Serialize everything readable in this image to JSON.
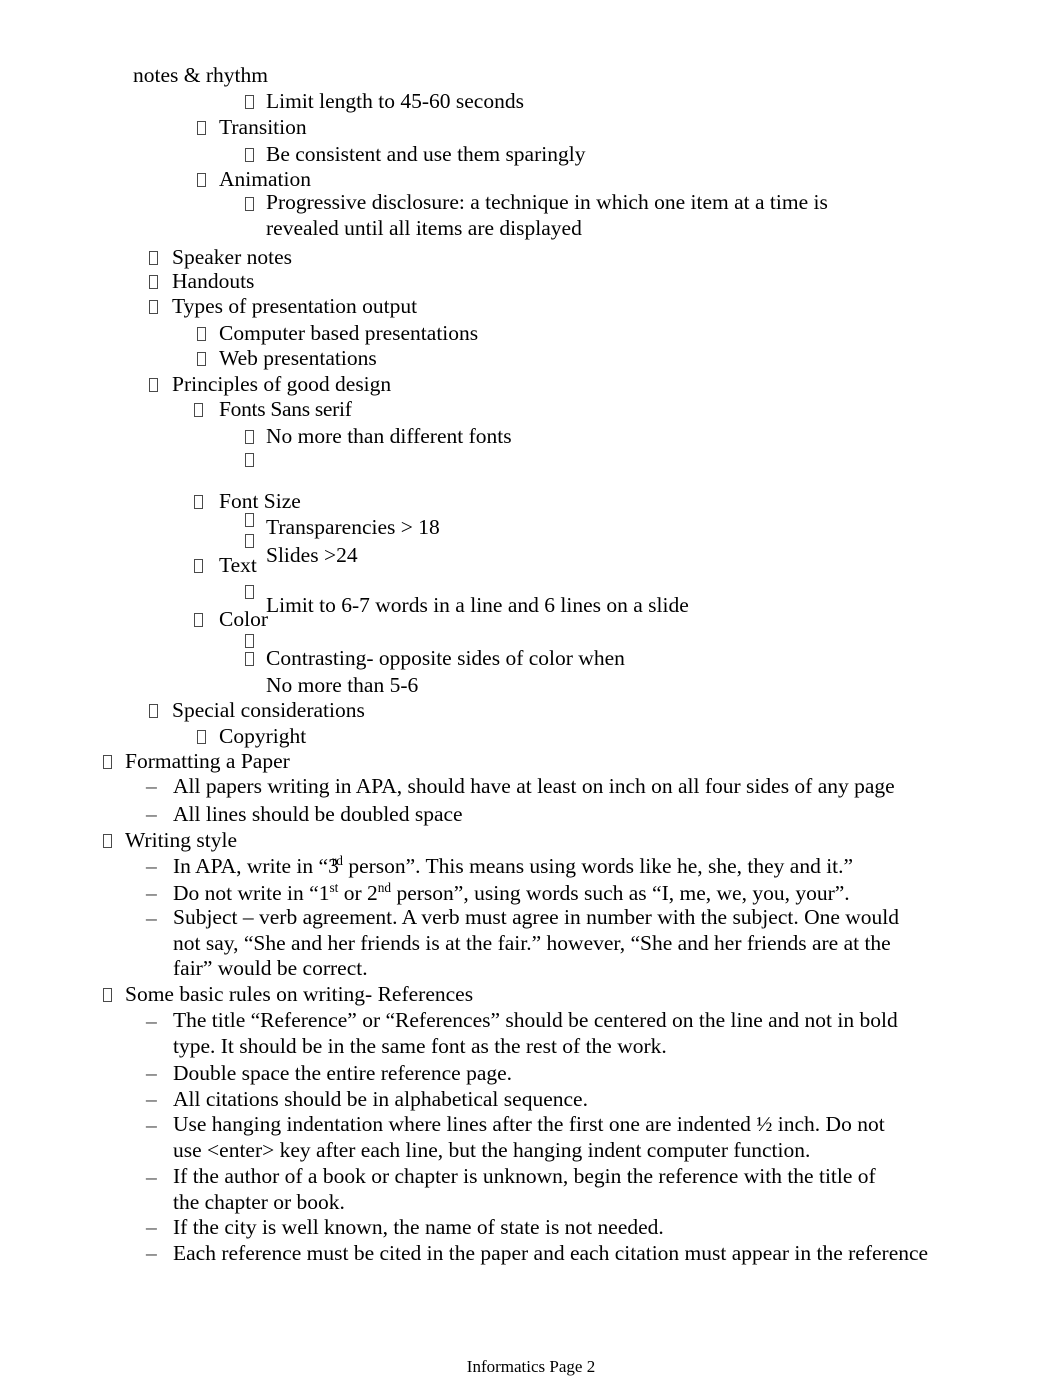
{
  "document": {
    "footer": "Informatics Page 2",
    "page_number": 2,
    "notebook_section": "Informatics",
    "bullet_glyph": "missing-glyph-box",
    "dash_glyph": "–",
    "text_color": "#000000",
    "background_color": "#ffffff"
  },
  "outline": {
    "continued_line": "notes & rhythm",
    "items": [
      {
        "id": "limit_length",
        "level": 4,
        "text": "Limit length to 45-60 seconds"
      },
      {
        "id": "transition",
        "level": 3,
        "text": "Transition"
      },
      {
        "id": "be_consistent",
        "level": 4,
        "text": "Be consistent and use them sparingly"
      },
      {
        "id": "animation",
        "level": 3,
        "text": "Animation"
      },
      {
        "id": "progressive",
        "level": 4,
        "text": "Progressive disclosure: a technique in which one item at a time is revealed until all items are displayed"
      },
      {
        "id": "speaker_notes",
        "level": 2,
        "text": "Speaker notes"
      },
      {
        "id": "handouts",
        "level": 2,
        "text": "Handouts"
      },
      {
        "id": "types_output",
        "level": 2,
        "text": "Types of presentation output"
      },
      {
        "id": "computer_based",
        "level": 3,
        "text": "Computer based presentations"
      },
      {
        "id": "web_pres",
        "level": 3,
        "text": "Web presentations"
      },
      {
        "id": "principles",
        "level": 2,
        "text": "Principles of good design"
      },
      {
        "id": "fonts",
        "level": 3,
        "text": "Fonts Sans serif"
      },
      {
        "id": "no_more_fonts",
        "level": 4,
        "text": "No more than different fonts"
      },
      {
        "id": "empty_bullet_1",
        "level": 4,
        "text": ""
      },
      {
        "id": "font_size",
        "level": 3,
        "text": "Font Size"
      },
      {
        "id": "transparencies",
        "level": 4,
        "text": "Transparencies > 18"
      },
      {
        "id": "slides",
        "level": 4,
        "text": "Slides >24"
      },
      {
        "id": "text_heading",
        "level": 3,
        "text": "Text"
      },
      {
        "id": "limit_words",
        "level": 4,
        "text": "Limit to 6-7 words in a line and 6 lines on a slide"
      },
      {
        "id": "color_heading",
        "level": 3,
        "text": "Color"
      },
      {
        "id": "contrasting",
        "level": 4,
        "text": "Contrasting- opposite sides of color when"
      },
      {
        "id": "no_more_56",
        "level": 4,
        "text": "No more than 5-6"
      },
      {
        "id": "special_cons",
        "level": 2,
        "text": "Special considerations"
      },
      {
        "id": "copyright",
        "level": 3,
        "text": "Copyright"
      },
      {
        "id": "formatting",
        "level": 1,
        "text": "Formatting a Paper"
      },
      {
        "id": "all_papers",
        "level": 2,
        "style": "dash",
        "text": "All papers writing in APA, should have at least on inch on all four sides of any page"
      },
      {
        "id": "all_lines",
        "level": 2,
        "style": "dash",
        "text": "All lines should be doubled space"
      },
      {
        "id": "writing_style",
        "level": 1,
        "text": "Writing style"
      },
      {
        "id": "in_apa",
        "level": 2,
        "style": "dash",
        "text_parts": [
          "In APA, write in “3",
          "rd",
          " person”. This means using words like he, she, they and it.”"
        ]
      },
      {
        "id": "do_not_write",
        "level": 2,
        "style": "dash",
        "text_parts": [
          "Do not write in “1",
          "st",
          " or 2",
          "nd",
          " person”, using words such as “I, me, we, you, your”."
        ]
      },
      {
        "id": "subject_verb",
        "level": 2,
        "style": "dash",
        "text": "Subject – verb agreement. A verb must agree in number with the subject. One would not say, “She and her friends is at the fair.” however, “She and her friends are at the fair” would be correct."
      },
      {
        "id": "some_basic",
        "level": 1,
        "text": "Some basic rules on writing- References"
      },
      {
        "id": "title_ref",
        "level": 2,
        "style": "dash",
        "text": "The title “Reference” or “References” should be centered on the line and not in bold type. It should be in the same font as the rest of the work."
      },
      {
        "id": "double_space",
        "level": 2,
        "style": "dash",
        "text": "Double space the entire reference page."
      },
      {
        "id": "alphabetical",
        "level": 2,
        "style": "dash",
        "text": "All citations should be in alphabetical sequence."
      },
      {
        "id": "hanging_indent",
        "level": 2,
        "style": "dash",
        "text": "Use hanging indentation where lines after the first one are indented ½ inch. Do not use <enter> key after each line, but the hanging indent computer function."
      },
      {
        "id": "author_unknown",
        "level": 2,
        "style": "dash",
        "text": "If the author of a book or chapter is unknown, begin the reference with the title of the chapter or book."
      },
      {
        "id": "city_known",
        "level": 2,
        "style": "dash",
        "text": "If the city is well known, the name of state is not needed."
      },
      {
        "id": "each_reference",
        "level": 2,
        "style": "dash",
        "text": "Each reference must be cited in the paper and each citation must appear in the reference"
      }
    ]
  }
}
